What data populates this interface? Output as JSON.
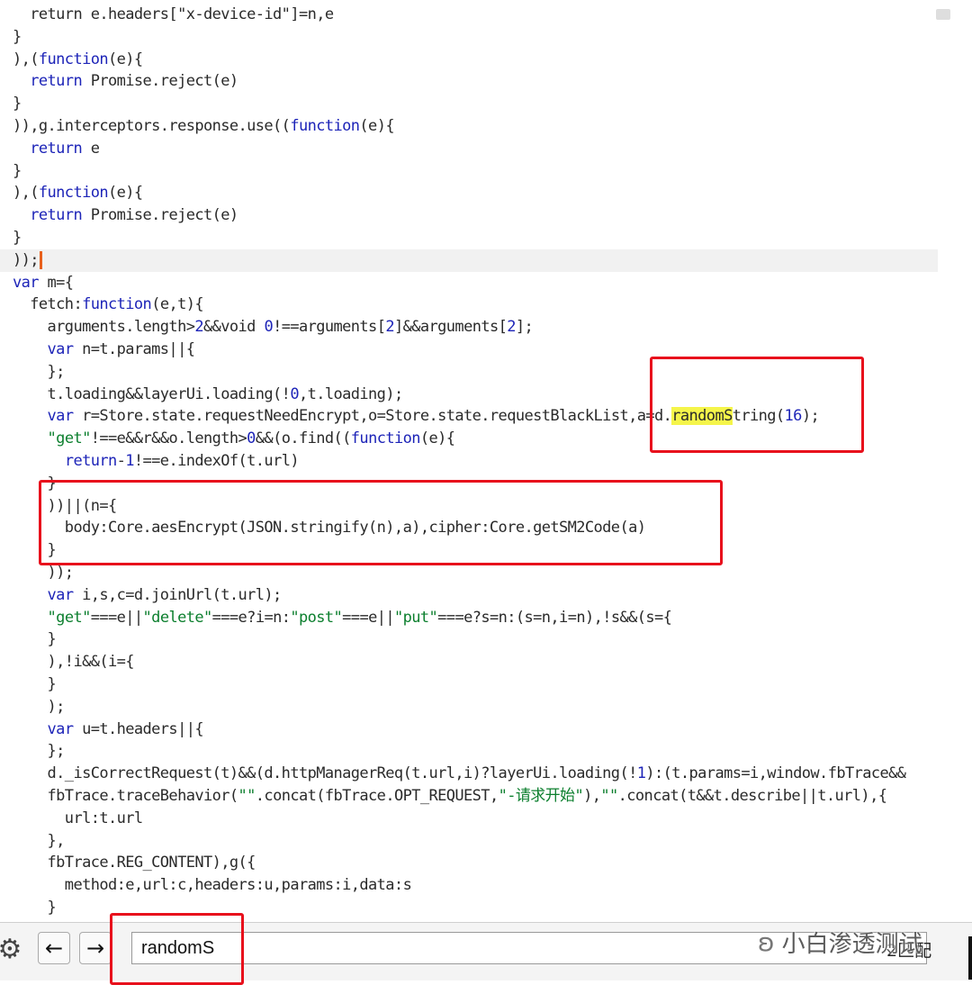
{
  "editor": {
    "lines": [
      {
        "segs": [
          {
            "t": "  return e.headers[\"x-device-id\"]=n,e"
          }
        ]
      },
      {
        "segs": [
          {
            "t": "}"
          }
        ]
      },
      {
        "segs": [
          {
            "t": "),("
          },
          {
            "t": "function",
            "k": "kw"
          },
          {
            "t": "(e){"
          }
        ]
      },
      {
        "segs": [
          {
            "t": "  "
          },
          {
            "t": "return",
            "k": "kw"
          },
          {
            "t": " Promise.reject(e)"
          }
        ]
      },
      {
        "segs": [
          {
            "t": "}"
          }
        ]
      },
      {
        "segs": [
          {
            "t": ")),g.interceptors.response.use(("
          },
          {
            "t": "function",
            "k": "kw"
          },
          {
            "t": "(e){"
          }
        ]
      },
      {
        "segs": [
          {
            "t": "  "
          },
          {
            "t": "return",
            "k": "kw"
          },
          {
            "t": " e"
          }
        ]
      },
      {
        "segs": [
          {
            "t": "}"
          }
        ]
      },
      {
        "segs": [
          {
            "t": "),("
          },
          {
            "t": "function",
            "k": "kw"
          },
          {
            "t": "(e){"
          }
        ]
      },
      {
        "segs": [
          {
            "t": "  "
          },
          {
            "t": "return",
            "k": "kw"
          },
          {
            "t": " Promise.reject(e)"
          }
        ]
      },
      {
        "segs": [
          {
            "t": "}"
          }
        ]
      },
      {
        "segs": [
          {
            "t": "));"
          }
        ],
        "active": true,
        "cursor": true
      },
      {
        "segs": [
          {
            "t": "var",
            "k": "kw"
          },
          {
            "t": " m={"
          }
        ]
      },
      {
        "segs": [
          {
            "t": "  fetch:"
          },
          {
            "t": "function",
            "k": "kw"
          },
          {
            "t": "(e,t){"
          }
        ]
      },
      {
        "segs": [
          {
            "t": "    arguments.length>"
          },
          {
            "t": "2",
            "k": "num"
          },
          {
            "t": "&&void "
          },
          {
            "t": "0",
            "k": "num"
          },
          {
            "t": "!==arguments["
          },
          {
            "t": "2",
            "k": "num"
          },
          {
            "t": "]&&arguments["
          },
          {
            "t": "2",
            "k": "num"
          },
          {
            "t": "];"
          }
        ]
      },
      {
        "segs": [
          {
            "t": "    "
          },
          {
            "t": "var",
            "k": "kw"
          },
          {
            "t": " n=t.params||{"
          }
        ]
      },
      {
        "segs": [
          {
            "t": "    };"
          }
        ]
      },
      {
        "segs": [
          {
            "t": "    t.loading&&layerUi.loading(!"
          },
          {
            "t": "0",
            "k": "num"
          },
          {
            "t": ",t.loading);"
          }
        ]
      },
      {
        "segs": [
          {
            "t": "    "
          },
          {
            "t": "var",
            "k": "kw"
          },
          {
            "t": " r=Store.state.requestNeedEncrypt,o=Store.state.requestBlackList,a=d."
          },
          {
            "t": "randomS",
            "k": "hl"
          },
          {
            "t": "tring("
          },
          {
            "t": "16",
            "k": "num"
          },
          {
            "t": ");"
          }
        ]
      },
      {
        "segs": [
          {
            "t": "    "
          },
          {
            "t": "\"get\"",
            "k": "str"
          },
          {
            "t": "!==e&&r&&o.length>"
          },
          {
            "t": "0",
            "k": "num"
          },
          {
            "t": "&&(o.find(("
          },
          {
            "t": "function",
            "k": "kw"
          },
          {
            "t": "(e){"
          }
        ]
      },
      {
        "segs": [
          {
            "t": "      "
          },
          {
            "t": "return",
            "k": "kw"
          },
          {
            "t": "-"
          },
          {
            "t": "1",
            "k": "num"
          },
          {
            "t": "!==e.indexOf(t.url)"
          }
        ]
      },
      {
        "segs": [
          {
            "t": "    }"
          }
        ]
      },
      {
        "segs": [
          {
            "t": "    ))||(n={"
          }
        ]
      },
      {
        "segs": [
          {
            "t": "      body:Core.aesEncrypt(JSON.stringify(n),a),cipher:Core.getSM2Code(a)"
          }
        ]
      },
      {
        "segs": [
          {
            "t": "    }"
          }
        ]
      },
      {
        "segs": [
          {
            "t": "    ));"
          }
        ]
      },
      {
        "segs": [
          {
            "t": "    "
          },
          {
            "t": "var",
            "k": "kw"
          },
          {
            "t": " i,s,c=d.joinUrl(t.url);"
          }
        ]
      },
      {
        "segs": [
          {
            "t": "    "
          },
          {
            "t": "\"get\"",
            "k": "str"
          },
          {
            "t": "===e||"
          },
          {
            "t": "\"delete\"",
            "k": "str"
          },
          {
            "t": "===e?i=n:"
          },
          {
            "t": "\"post\"",
            "k": "str"
          },
          {
            "t": "===e||"
          },
          {
            "t": "\"put\"",
            "k": "str"
          },
          {
            "t": "===e?s=n:(s=n,i=n),!s&&(s={"
          }
        ]
      },
      {
        "segs": [
          {
            "t": "    }"
          }
        ]
      },
      {
        "segs": [
          {
            "t": "    ),!i&&(i={"
          }
        ]
      },
      {
        "segs": [
          {
            "t": "    }"
          }
        ]
      },
      {
        "segs": [
          {
            "t": "    );"
          }
        ]
      },
      {
        "segs": [
          {
            "t": "    "
          },
          {
            "t": "var",
            "k": "kw"
          },
          {
            "t": " u=t.headers||{"
          }
        ]
      },
      {
        "segs": [
          {
            "t": "    };"
          }
        ]
      },
      {
        "segs": [
          {
            "t": "    d._isCorrectRequest(t)&&(d.httpManagerReq(t.url,i)?layerUi.loading(!"
          },
          {
            "t": "1",
            "k": "num"
          },
          {
            "t": "):(t.params=i,window.fbTrace&&"
          }
        ]
      },
      {
        "segs": [
          {
            "t": "    fbTrace.traceBehavior("
          },
          {
            "t": "\"\"",
            "k": "str"
          },
          {
            "t": ".concat(fbTrace.OPT_REQUEST,"
          },
          {
            "t": "\"-请求开始\"",
            "k": "str"
          },
          {
            "t": "),"
          },
          {
            "t": "\"\"",
            "k": "str"
          },
          {
            "t": ".concat(t&&t.describe||t.url),{"
          }
        ]
      },
      {
        "segs": [
          {
            "t": "      url:t.url"
          }
        ]
      },
      {
        "segs": [
          {
            "t": "    },"
          }
        ]
      },
      {
        "segs": [
          {
            "t": "    fbTrace.REG_CONTENT),g({"
          }
        ]
      },
      {
        "segs": [
          {
            "t": "      method:e,url:c,headers:u,params:i,data:s"
          }
        ]
      },
      {
        "segs": [
          {
            "t": "    }"
          }
        ]
      }
    ]
  },
  "search": {
    "query": "randomS",
    "match_count": "2匹配",
    "settings_icon": "gear-icon",
    "prev_icon": "arrow-left-icon",
    "next_icon": "arrow-right-icon",
    "prev_glyph": "←",
    "next_glyph": "→",
    "settings_glyph": "⚙"
  },
  "watermark": {
    "text": "小白渗透测试",
    "logo_icon": "wechat-logo-icon",
    "logo_glyph": "ʚ"
  },
  "colors": {
    "keyword": "#1d24b8",
    "string": "#0c7f2e",
    "highlight": "#f5f54a",
    "annotation_box": "#e8101c",
    "cursor": "#e8601c"
  }
}
